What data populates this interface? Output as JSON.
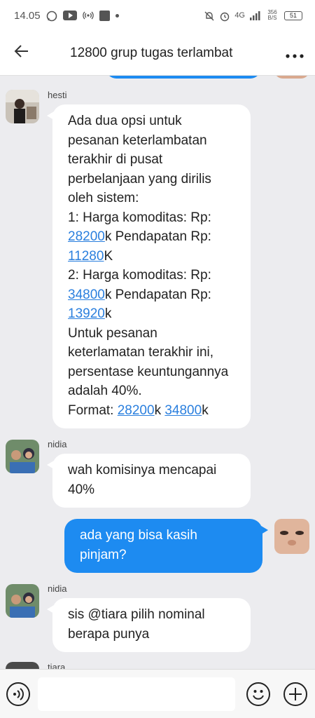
{
  "status_bar": {
    "time": "14.05",
    "network": "4G",
    "speed": "356 B/S",
    "battery": "51"
  },
  "header": {
    "title": "12800 grup tugas terlambat"
  },
  "messages": [
    {
      "sender": "hesti",
      "direction": "incoming",
      "lines": [
        [
          {
            "t": "Ada dua opsi untuk"
          }
        ],
        [
          {
            "t": "pesanan keterlambatan"
          }
        ],
        [
          {
            "t": "terakhir di pusat"
          }
        ],
        [
          {
            "t": "perbelanjaan yang dirilis"
          }
        ],
        [
          {
            "t": "oleh sistem:"
          }
        ],
        [
          {
            "t": "1: Harga komoditas: Rp:"
          }
        ],
        [
          {
            "t": "28200",
            "link": true
          },
          {
            "t": "k Pendapatan Rp:"
          }
        ],
        [
          {
            "t": "11280",
            "link": true
          },
          {
            "t": "K"
          }
        ],
        [
          {
            "t": "2: Harga komoditas: Rp:"
          }
        ],
        [
          {
            "t": "34800",
            "link": true
          },
          {
            "t": "k Pendapatan Rp:"
          }
        ],
        [
          {
            "t": "13920",
            "link": true
          },
          {
            "t": "k"
          }
        ],
        [
          {
            "t": "Untuk pesanan"
          }
        ],
        [
          {
            "t": "keterlamatan terakhir ini,"
          }
        ],
        [
          {
            "t": "persentase keuntungannya"
          }
        ],
        [
          {
            "t": "adalah 40%."
          }
        ],
        [
          {
            "t": "Format: "
          },
          {
            "t": "28200",
            "link": true
          },
          {
            "t": "k "
          },
          {
            "t": "34800",
            "link": true
          },
          {
            "t": "k"
          }
        ]
      ]
    },
    {
      "sender": "nidia",
      "direction": "incoming",
      "lines": [
        [
          {
            "t": "wah komisinya mencapai"
          }
        ],
        [
          {
            "t": "40%"
          }
        ]
      ]
    },
    {
      "sender": "",
      "direction": "outgoing",
      "lines": [
        [
          {
            "t": "ada yang bisa kasih"
          }
        ],
        [
          {
            "t": "pinjam?"
          }
        ]
      ]
    },
    {
      "sender": "nidia",
      "direction": "incoming",
      "lines": [
        [
          {
            "t": "sis @tiara pilih nominal"
          }
        ],
        [
          {
            "t": "berapa punya"
          }
        ]
      ]
    },
    {
      "sender": "tiara",
      "direction": "incoming",
      "lines": []
    }
  ],
  "input": {
    "placeholder": ""
  },
  "colors": {
    "outgoing_bubble": "#1d8bf1",
    "link": "#2a7fde",
    "chat_background": "#ececef"
  }
}
